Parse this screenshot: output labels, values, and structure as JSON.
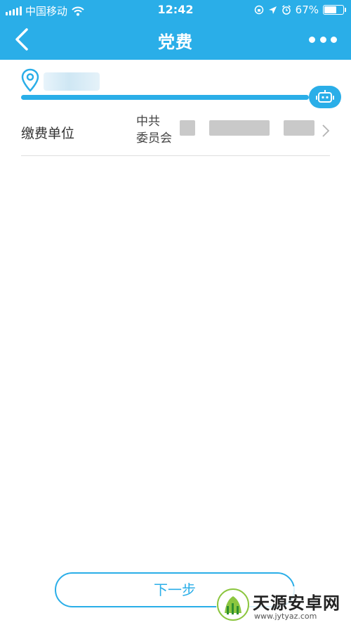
{
  "status_bar": {
    "carrier": "中国移动",
    "time": "12:42",
    "battery_percent": "67%",
    "battery_level": 0.67
  },
  "nav": {
    "title": "党费",
    "back_icon": "chevron-left-icon",
    "more_icon": "more-dots-icon"
  },
  "location": {
    "icon": "location-pin-icon",
    "robot_icon": "robot-icon"
  },
  "payment_unit": {
    "label": "缴费单位",
    "value_line1": "中共",
    "value_line2": "委员会",
    "chevron_icon": "chevron-right-icon"
  },
  "next_button": {
    "label": "下一步"
  },
  "watermark": {
    "title": "天源安卓网",
    "url": "www.jytyaz.com"
  },
  "colors": {
    "accent": "#2aaee8",
    "background": "#ffffff",
    "divider": "#dedede"
  }
}
